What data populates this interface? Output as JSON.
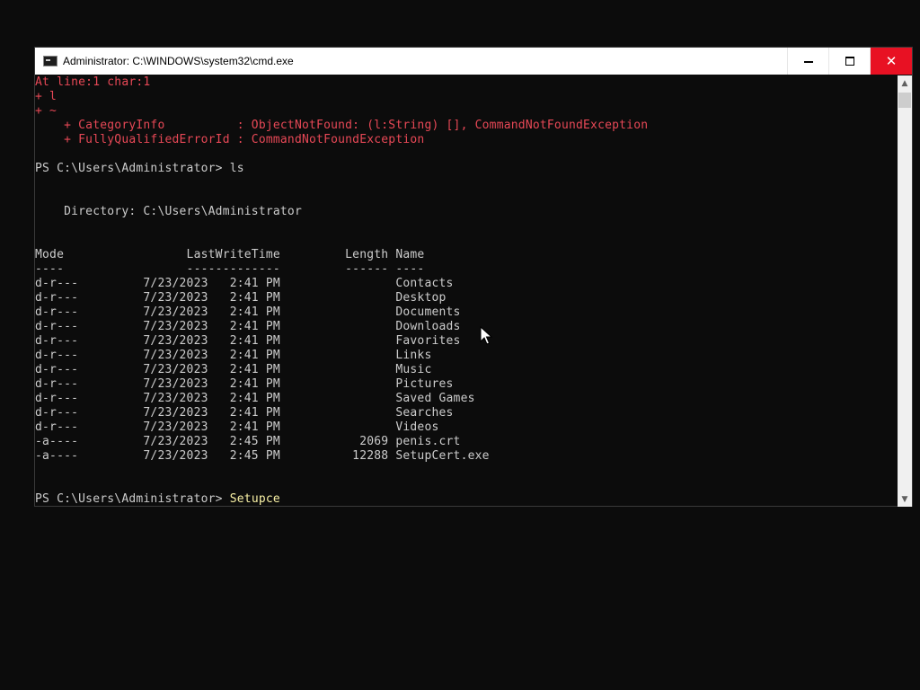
{
  "window": {
    "title": "Administrator: C:\\WINDOWS\\system32\\cmd.exe",
    "minimize_label": "",
    "maximize_label": "",
    "close_label": "✕"
  },
  "console": {
    "lines": [
      {
        "text": "At line:1 char:1",
        "style": "err"
      },
      {
        "text": "+ l",
        "style": "err"
      },
      {
        "text": "+ ~",
        "style": "err"
      },
      {
        "text": "    + CategoryInfo          : ObjectNotFound: (l:String) [], CommandNotFoundException",
        "style": "err"
      },
      {
        "text": "    + FullyQualifiedErrorId : CommandNotFoundException",
        "style": "err"
      },
      {
        "text": "",
        "style": "normal"
      },
      {
        "text": "PS C:\\Users\\Administrator> ls",
        "style": "normal"
      },
      {
        "text": "",
        "style": "normal"
      },
      {
        "text": "",
        "style": "normal"
      },
      {
        "text": "    Directory: C:\\Users\\Administrator",
        "style": "normal"
      },
      {
        "text": "",
        "style": "normal"
      },
      {
        "text": "",
        "style": "normal"
      },
      {
        "text": "Mode                 LastWriteTime         Length Name",
        "style": "normal"
      },
      {
        "text": "----                 -------------         ------ ----",
        "style": "normal"
      },
      {
        "text": "d-r---         7/23/2023   2:41 PM                Contacts",
        "style": "normal"
      },
      {
        "text": "d-r---         7/23/2023   2:41 PM                Desktop",
        "style": "normal"
      },
      {
        "text": "d-r---         7/23/2023   2:41 PM                Documents",
        "style": "normal"
      },
      {
        "text": "d-r---         7/23/2023   2:41 PM                Downloads",
        "style": "normal"
      },
      {
        "text": "d-r---         7/23/2023   2:41 PM                Favorites",
        "style": "normal"
      },
      {
        "text": "d-r---         7/23/2023   2:41 PM                Links",
        "style": "normal"
      },
      {
        "text": "d-r---         7/23/2023   2:41 PM                Music",
        "style": "normal"
      },
      {
        "text": "d-r---         7/23/2023   2:41 PM                Pictures",
        "style": "normal"
      },
      {
        "text": "d-r---         7/23/2023   2:41 PM                Saved Games",
        "style": "normal"
      },
      {
        "text": "d-r---         7/23/2023   2:41 PM                Searches",
        "style": "normal"
      },
      {
        "text": "d-r---         7/23/2023   2:41 PM                Videos",
        "style": "normal"
      },
      {
        "text": "-a----         7/23/2023   2:45 PM           2069 penis.crt",
        "style": "normal"
      },
      {
        "text": "-a----         7/23/2023   2:45 PM          12288 SetupCert.exe",
        "style": "normal"
      },
      {
        "text": "",
        "style": "normal"
      },
      {
        "text": "",
        "style": "normal"
      }
    ],
    "prompt": "PS C:\\Users\\Administrator> ",
    "current_input": "Setupce"
  },
  "colors": {
    "error": "#e74856",
    "text": "#cccccc",
    "input": "#f9f1a5",
    "close_button": "#e81123"
  }
}
